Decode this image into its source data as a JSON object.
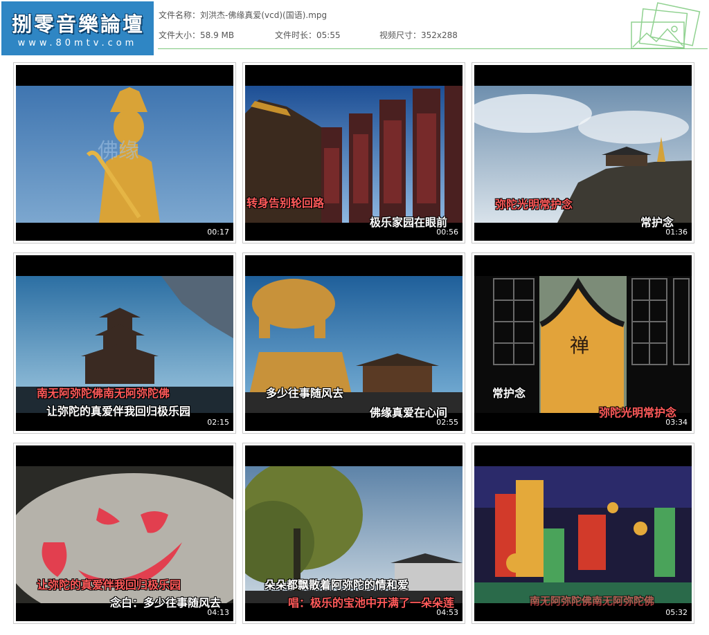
{
  "logo": {
    "brand": "捌零音樂論壇",
    "url": "www.80mtv.com"
  },
  "file": {
    "name_label": "文件名称：",
    "name": "刘洪杰-佛缘真爱(vcd)(国语).mpg",
    "size_label": "文件大小：",
    "size": "58.9 MB",
    "duration_label": "文件时长：",
    "duration": "05:55",
    "dims_label": "视频尺寸：",
    "dims": "352x288"
  },
  "thumbs": [
    {
      "time": "00:17",
      "lines": []
    },
    {
      "time": "00:56",
      "lines": [
        "转身告别轮回路",
        "极乐家园在眼前"
      ]
    },
    {
      "time": "01:36",
      "lines": [
        "弥陀光明常护念",
        "常护念"
      ]
    },
    {
      "time": "02:15",
      "lines": [
        "南无阿弥陀佛南无阿弥陀佛",
        "让弥陀的真爱伴我回归极乐园"
      ]
    },
    {
      "time": "02:55",
      "lines": [
        "多少往事随风去",
        "佛缘真爱在心间"
      ]
    },
    {
      "time": "03:34",
      "lines": [
        "常护念",
        "弥陀光明常护念"
      ]
    },
    {
      "time": "04:13",
      "lines": [
        "让弥陀的真爱伴我回归极乐园",
        "念白：多少往事随风去"
      ]
    },
    {
      "time": "04:53",
      "lines": [
        "朵朵都飘散着阿弥陀的情和爱",
        "唱：极乐的宝池中开满了一朵朵莲"
      ]
    },
    {
      "time": "05:32",
      "lines": [
        "南无阿弥陀佛南无阿弥陀佛"
      ]
    }
  ]
}
